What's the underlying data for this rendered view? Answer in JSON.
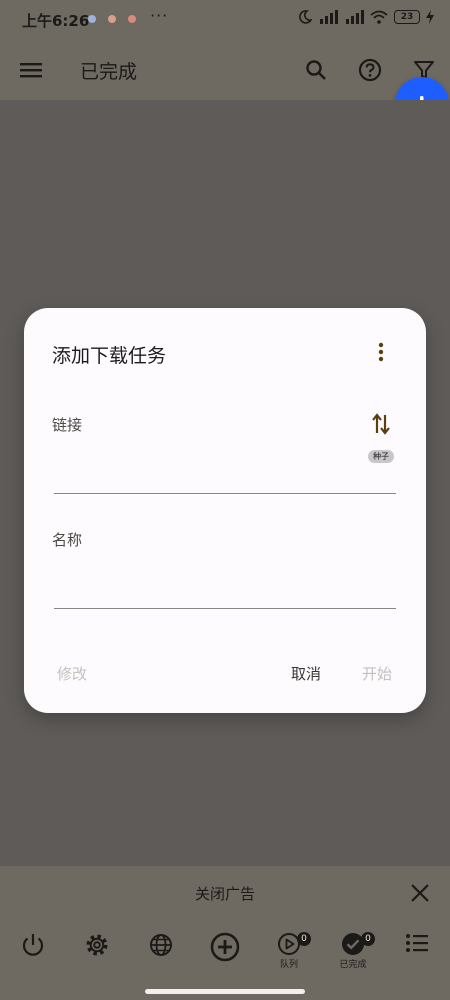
{
  "status_bar": {
    "time": "上午6:26",
    "more": "···",
    "battery": "23"
  },
  "app_bar": {
    "title": "已完成",
    "icons": [
      "menu-icon",
      "search-icon",
      "help-icon",
      "filter-icon"
    ]
  },
  "fab": {
    "icon": "bar-chart-icon",
    "color": "#1e5eff"
  },
  "dialog": {
    "title": "添加下载任务",
    "link_label": "链接",
    "seed_chip": "种子",
    "name_label": "名称",
    "modify_label": "修改",
    "cancel_label": "取消",
    "start_label": "开始"
  },
  "ad_bar": {
    "text": "关闭广告"
  },
  "bottom_nav": {
    "queue_label": "队列",
    "queue_badge": "0",
    "completed_label": "已完成",
    "completed_badge": "0"
  }
}
